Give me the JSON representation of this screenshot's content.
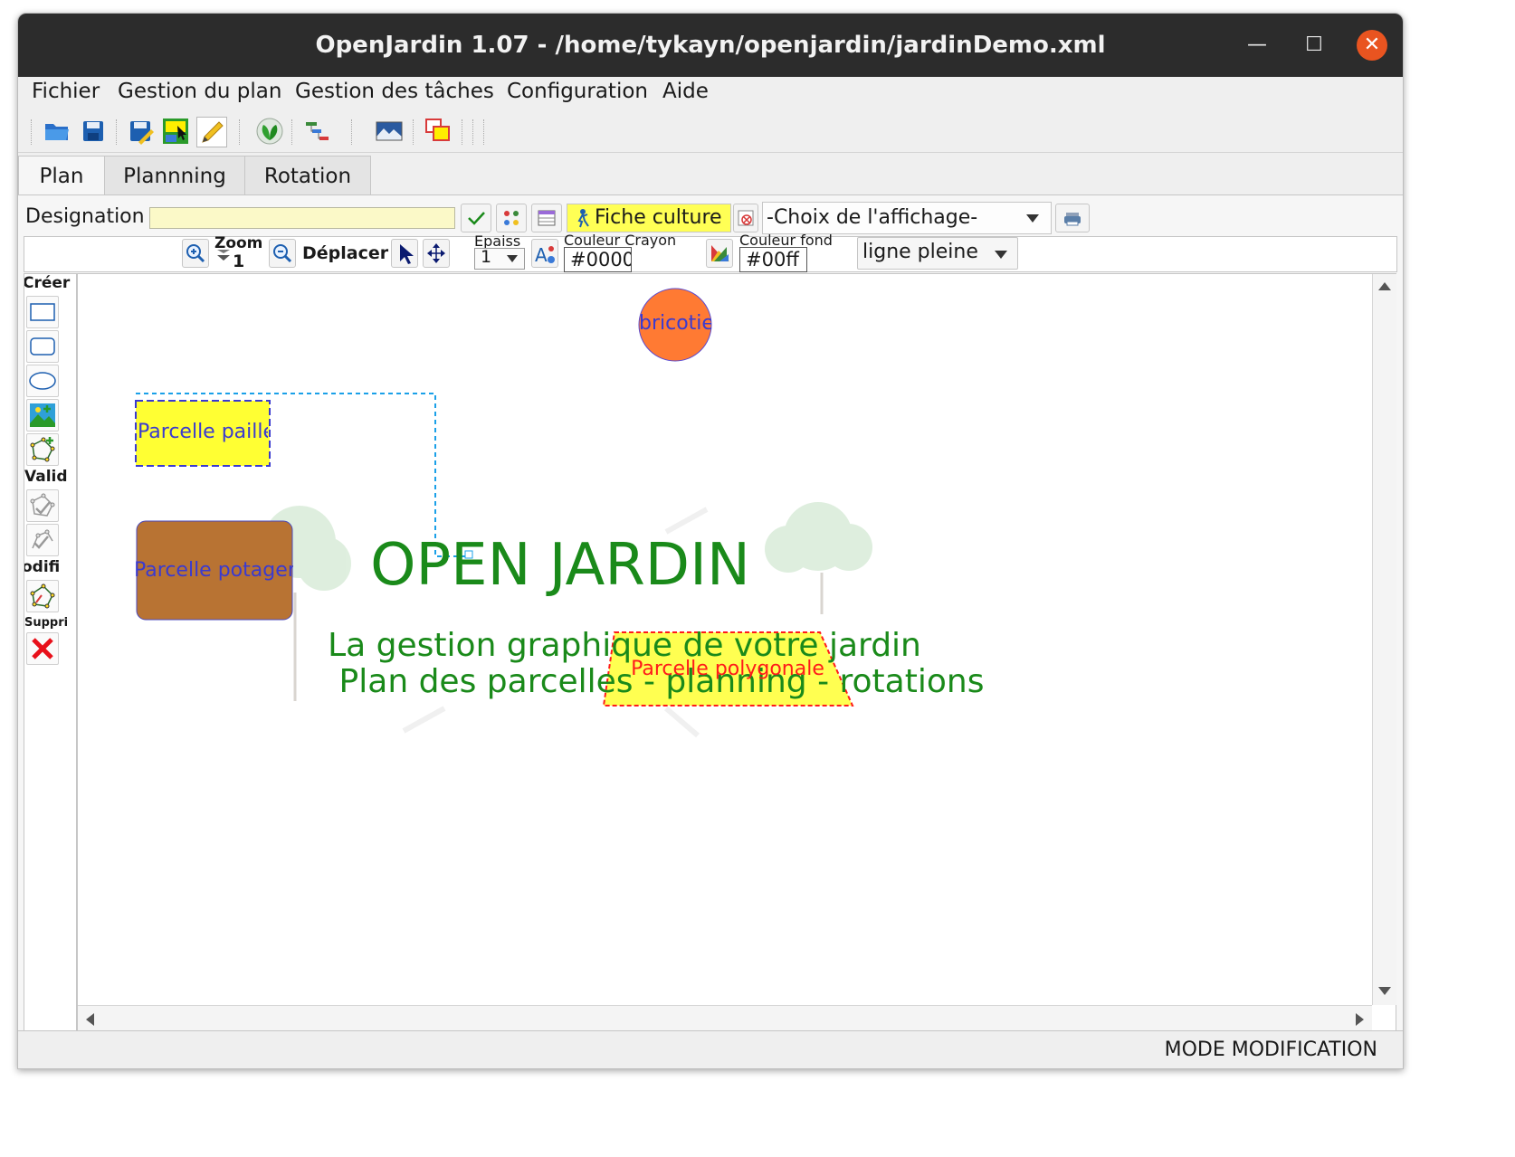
{
  "window": {
    "title": "OpenJardin 1.07 - /home/tykayn/openjardin/jardinDemo.xml"
  },
  "menu": [
    "Fichier",
    "Gestion du plan",
    "Gestion des tâches",
    "Configuration",
    "Aide"
  ],
  "tabs": {
    "plan": "Plan",
    "planning": "Plannning",
    "rotation": "Rotation"
  },
  "designation": {
    "label": "Designation",
    "value": "",
    "fiche_culture": "Fiche culture",
    "affichage": "-Choix de l'affichage-"
  },
  "toolrow": {
    "zoom_label": "Zoom",
    "zoom_value": "1",
    "move_label": "Déplacer",
    "epaisseur_label": "Epaiss",
    "epaisseur_value": "1",
    "couleur_crayon_label": "Couleur Crayon",
    "couleur_crayon_value": "#0000",
    "couleur_fond_label": "Couleur fond",
    "couleur_fond_value": "#00ff",
    "line_style": "ligne pleine"
  },
  "sidebar": {
    "create_label": "Créer",
    "validate_label": "Valid",
    "modify_label": "odifi",
    "delete_label": "Suppri"
  },
  "canvas": {
    "title": "OPEN JARDIN",
    "subtitle_1": "La gestion graphique de votre jardin",
    "subtitle_2": "Plan des parcelles - planning - rotations",
    "shape_circle": "bricotier",
    "shape_paillee": "Parcelle paillée",
    "shape_potager": "Parcelle potager",
    "shape_polygon": "Parcelle polygonale"
  },
  "status": "MODE MODIFICATION",
  "colors": {
    "titlebar": "#2c2c2c",
    "close": "#e95420",
    "title_green": "#1a8a1a",
    "circle": "#ff7a33",
    "yellow": "#ffff33",
    "potager": "#b87333",
    "label_blue": "#3a3ad0",
    "polygon_label": "#ff1a1a"
  }
}
